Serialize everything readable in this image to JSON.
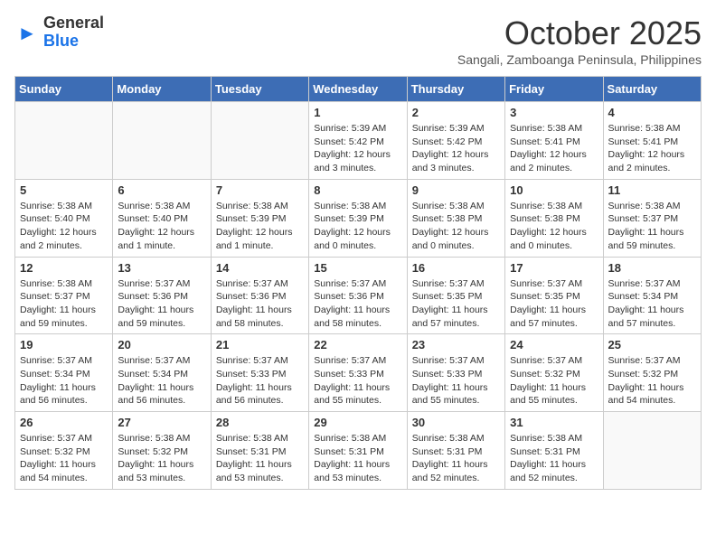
{
  "header": {
    "logo_general": "General",
    "logo_blue": "Blue",
    "month_title": "October 2025",
    "subtitle": "Sangali, Zamboanga Peninsula, Philippines"
  },
  "days_of_week": [
    "Sunday",
    "Monday",
    "Tuesday",
    "Wednesday",
    "Thursday",
    "Friday",
    "Saturday"
  ],
  "weeks": [
    [
      {
        "num": "",
        "info": ""
      },
      {
        "num": "",
        "info": ""
      },
      {
        "num": "",
        "info": ""
      },
      {
        "num": "1",
        "info": "Sunrise: 5:39 AM\nSunset: 5:42 PM\nDaylight: 12 hours and 3 minutes."
      },
      {
        "num": "2",
        "info": "Sunrise: 5:39 AM\nSunset: 5:42 PM\nDaylight: 12 hours and 3 minutes."
      },
      {
        "num": "3",
        "info": "Sunrise: 5:38 AM\nSunset: 5:41 PM\nDaylight: 12 hours and 2 minutes."
      },
      {
        "num": "4",
        "info": "Sunrise: 5:38 AM\nSunset: 5:41 PM\nDaylight: 12 hours and 2 minutes."
      }
    ],
    [
      {
        "num": "5",
        "info": "Sunrise: 5:38 AM\nSunset: 5:40 PM\nDaylight: 12 hours and 2 minutes."
      },
      {
        "num": "6",
        "info": "Sunrise: 5:38 AM\nSunset: 5:40 PM\nDaylight: 12 hours and 1 minute."
      },
      {
        "num": "7",
        "info": "Sunrise: 5:38 AM\nSunset: 5:39 PM\nDaylight: 12 hours and 1 minute."
      },
      {
        "num": "8",
        "info": "Sunrise: 5:38 AM\nSunset: 5:39 PM\nDaylight: 12 hours and 0 minutes."
      },
      {
        "num": "9",
        "info": "Sunrise: 5:38 AM\nSunset: 5:38 PM\nDaylight: 12 hours and 0 minutes."
      },
      {
        "num": "10",
        "info": "Sunrise: 5:38 AM\nSunset: 5:38 PM\nDaylight: 12 hours and 0 minutes."
      },
      {
        "num": "11",
        "info": "Sunrise: 5:38 AM\nSunset: 5:37 PM\nDaylight: 11 hours and 59 minutes."
      }
    ],
    [
      {
        "num": "12",
        "info": "Sunrise: 5:38 AM\nSunset: 5:37 PM\nDaylight: 11 hours and 59 minutes."
      },
      {
        "num": "13",
        "info": "Sunrise: 5:37 AM\nSunset: 5:36 PM\nDaylight: 11 hours and 59 minutes."
      },
      {
        "num": "14",
        "info": "Sunrise: 5:37 AM\nSunset: 5:36 PM\nDaylight: 11 hours and 58 minutes."
      },
      {
        "num": "15",
        "info": "Sunrise: 5:37 AM\nSunset: 5:36 PM\nDaylight: 11 hours and 58 minutes."
      },
      {
        "num": "16",
        "info": "Sunrise: 5:37 AM\nSunset: 5:35 PM\nDaylight: 11 hours and 57 minutes."
      },
      {
        "num": "17",
        "info": "Sunrise: 5:37 AM\nSunset: 5:35 PM\nDaylight: 11 hours and 57 minutes."
      },
      {
        "num": "18",
        "info": "Sunrise: 5:37 AM\nSunset: 5:34 PM\nDaylight: 11 hours and 57 minutes."
      }
    ],
    [
      {
        "num": "19",
        "info": "Sunrise: 5:37 AM\nSunset: 5:34 PM\nDaylight: 11 hours and 56 minutes."
      },
      {
        "num": "20",
        "info": "Sunrise: 5:37 AM\nSunset: 5:34 PM\nDaylight: 11 hours and 56 minutes."
      },
      {
        "num": "21",
        "info": "Sunrise: 5:37 AM\nSunset: 5:33 PM\nDaylight: 11 hours and 56 minutes."
      },
      {
        "num": "22",
        "info": "Sunrise: 5:37 AM\nSunset: 5:33 PM\nDaylight: 11 hours and 55 minutes."
      },
      {
        "num": "23",
        "info": "Sunrise: 5:37 AM\nSunset: 5:33 PM\nDaylight: 11 hours and 55 minutes."
      },
      {
        "num": "24",
        "info": "Sunrise: 5:37 AM\nSunset: 5:32 PM\nDaylight: 11 hours and 55 minutes."
      },
      {
        "num": "25",
        "info": "Sunrise: 5:37 AM\nSunset: 5:32 PM\nDaylight: 11 hours and 54 minutes."
      }
    ],
    [
      {
        "num": "26",
        "info": "Sunrise: 5:37 AM\nSunset: 5:32 PM\nDaylight: 11 hours and 54 minutes."
      },
      {
        "num": "27",
        "info": "Sunrise: 5:38 AM\nSunset: 5:32 PM\nDaylight: 11 hours and 53 minutes."
      },
      {
        "num": "28",
        "info": "Sunrise: 5:38 AM\nSunset: 5:31 PM\nDaylight: 11 hours and 53 minutes."
      },
      {
        "num": "29",
        "info": "Sunrise: 5:38 AM\nSunset: 5:31 PM\nDaylight: 11 hours and 53 minutes."
      },
      {
        "num": "30",
        "info": "Sunrise: 5:38 AM\nSunset: 5:31 PM\nDaylight: 11 hours and 52 minutes."
      },
      {
        "num": "31",
        "info": "Sunrise: 5:38 AM\nSunset: 5:31 PM\nDaylight: 11 hours and 52 minutes."
      },
      {
        "num": "",
        "info": ""
      }
    ]
  ]
}
